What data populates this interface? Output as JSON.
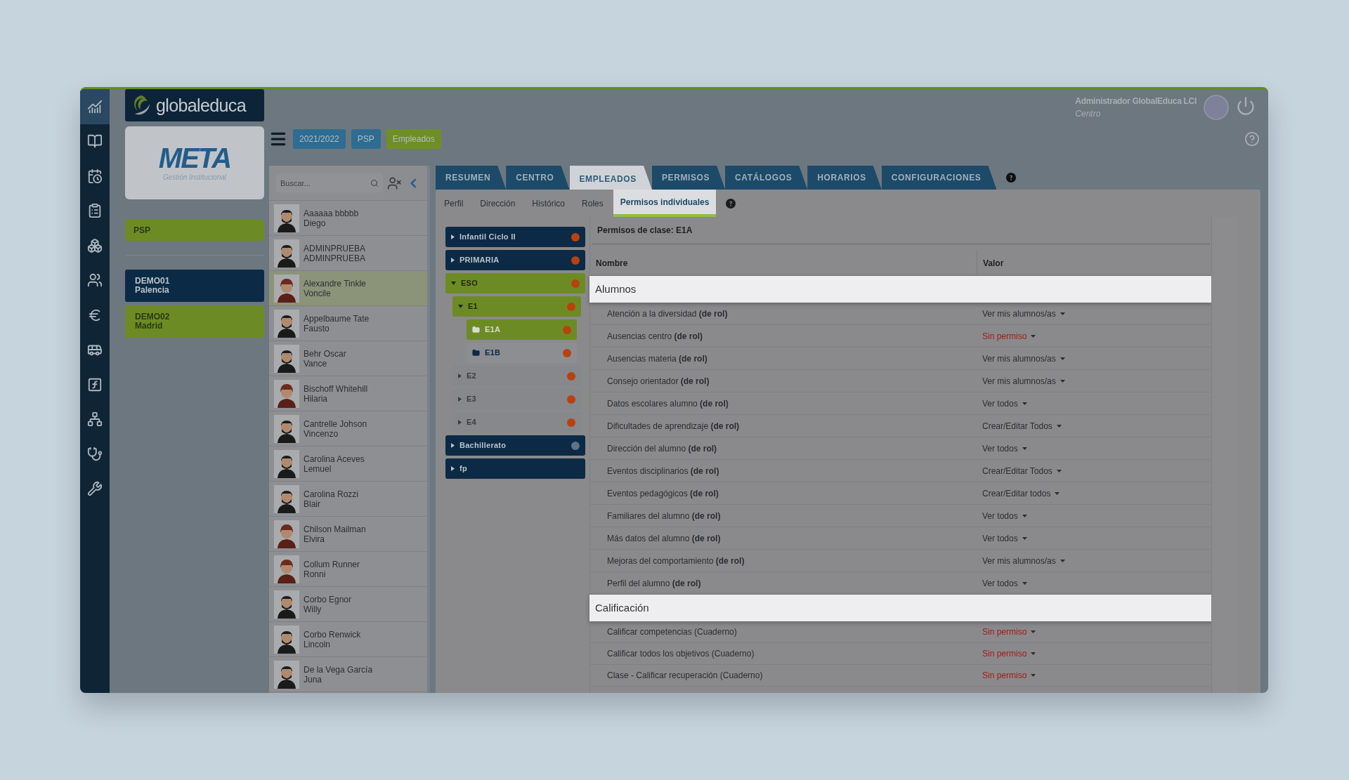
{
  "rail": [
    {
      "selected": true
    },
    {
      "selected": false
    },
    {
      "selected": false
    },
    {
      "selected": false
    },
    {
      "selected": false
    },
    {
      "selected": false
    },
    {
      "selected": false
    },
    {
      "selected": false
    },
    {
      "selected": false
    },
    {
      "selected": false
    },
    {
      "selected": false
    },
    {
      "selected": false
    }
  ],
  "brand": {
    "logo": "globaleduca",
    "product": "META",
    "product_subtitle": "Gestión Institucional"
  },
  "school": {
    "label": "PSP"
  },
  "centers": [
    {
      "code": "DEMO01",
      "city": "Palencia",
      "selected": true
    },
    {
      "code": "DEMO02",
      "city": "Madrid",
      "selected": false
    }
  ],
  "user": {
    "name": "Administrador GlobalEduca LCI",
    "role": "Centro"
  },
  "chips": [
    {
      "label": "2021/2022",
      "color": "#2e6c92"
    },
    {
      "label": "PSP",
      "color": "#2e6c92"
    },
    {
      "label": "Empleados",
      "color": "#6f8f24"
    }
  ],
  "search": {
    "placeholder": "Buscar..."
  },
  "employees": [
    {
      "surname": "Aaaaaa bbbbb",
      "name": "Diego",
      "kind": "male",
      "selected": false
    },
    {
      "surname": "ADMINPRUEBA",
      "name": "ADMINPRUEBA",
      "kind": "male",
      "selected": false
    },
    {
      "surname": "Alexandre Tinkle",
      "name": "Voncile",
      "kind": "female",
      "selected": true
    },
    {
      "surname": "Appelbaume Tate",
      "name": "Fausto",
      "kind": "male",
      "selected": false
    },
    {
      "surname": "Behr Oscar",
      "name": "Vance",
      "kind": "male",
      "selected": false
    },
    {
      "surname": "Bischoff Whitehill",
      "name": "Hilaria",
      "kind": "female",
      "selected": false
    },
    {
      "surname": "Cantrelle Johson",
      "name": "Vincenzo",
      "kind": "male",
      "selected": false
    },
    {
      "surname": "Carolina Aceves",
      "name": "Lemuel",
      "kind": "male",
      "selected": false
    },
    {
      "surname": "Carolina Rozzi",
      "name": "Blair",
      "kind": "male",
      "selected": false
    },
    {
      "surname": "Chilson Mailman",
      "name": "Elvira",
      "kind": "female",
      "selected": false
    },
    {
      "surname": "Collum Runner",
      "name": "Ronni",
      "kind": "female",
      "selected": false
    },
    {
      "surname": "Corbo Egnor",
      "name": "Willy",
      "kind": "male",
      "selected": false
    },
    {
      "surname": "Corbo Renwick",
      "name": "Lincoln",
      "kind": "male",
      "selected": false
    },
    {
      "surname": "De la Vega García",
      "name": "Juna",
      "kind": "male",
      "selected": false
    }
  ],
  "tabs": [
    {
      "label": "RESUMEN",
      "selected": false
    },
    {
      "label": "CENTRO",
      "selected": false
    },
    {
      "label": "EMPLEADOS",
      "selected": true
    },
    {
      "label": "PERMISOS",
      "selected": false
    },
    {
      "label": "CATÁLOGOS",
      "selected": false
    },
    {
      "label": "HORARIOS",
      "selected": false
    },
    {
      "label": "CONFIGURACIONES",
      "selected": false
    }
  ],
  "subtabs": [
    {
      "label": "Perfil",
      "selected": false
    },
    {
      "label": "Dirección",
      "selected": false
    },
    {
      "label": "Histórico",
      "selected": false
    },
    {
      "label": "Roles",
      "selected": false
    },
    {
      "label": "Permisos individuales",
      "selected": true
    }
  ],
  "tree": [
    {
      "label": "Infantil Ciclo II",
      "kind": "group",
      "expanded": false,
      "color": "#b8420f"
    },
    {
      "label": "PRIMARIA",
      "kind": "group",
      "expanded": false,
      "color": "#b8420f"
    },
    {
      "label": "ESO",
      "kind": "group",
      "expanded": true,
      "color": "#b8420f",
      "children": [
        {
          "label": "E1",
          "kind": "group",
          "expanded": true,
          "color": "#b8420f",
          "children": [
            {
              "label": "E1A",
              "kind": "folder",
              "selected": true,
              "color": "#b8420f"
            },
            {
              "label": "E1B",
              "kind": "folder",
              "selected": false,
              "color": "#b8420f"
            }
          ]
        },
        {
          "label": "E2",
          "kind": "group",
          "expanded": false,
          "color": "#b8420f"
        },
        {
          "label": "E3",
          "kind": "group",
          "expanded": false,
          "color": "#b8420f"
        },
        {
          "label": "E4",
          "kind": "group",
          "expanded": false,
          "color": "#b8420f"
        }
      ]
    },
    {
      "label": "Bachillerato",
      "kind": "group",
      "expanded": false,
      "color": "#5d7488"
    },
    {
      "label": "fp",
      "kind": "group",
      "expanded": false
    }
  ],
  "permissions": {
    "title": "Permisos de clase: E1A",
    "columns": [
      "Nombre",
      "Valor"
    ],
    "groups": [
      {
        "title": "Alumnos",
        "rows": [
          {
            "name": "Atención a la diversidad **(de rol)**",
            "value": "Ver mis alumnos/as",
            "denied": false
          },
          {
            "name": "Ausencias centro **(de rol)**",
            "value": "Sin permiso",
            "denied": true
          },
          {
            "name": "Ausencias materia **(de rol)**",
            "value": "Ver mis alumnos/as",
            "denied": false
          },
          {
            "name": "Consejo orientador **(de rol)**",
            "value": "Ver mis alumnos/as",
            "denied": false
          },
          {
            "name": "Datos escolares alumno **(de rol)**",
            "value": "Ver todos",
            "denied": false
          },
          {
            "name": "Dificultades de aprendizaje **(de rol)**",
            "value": "Crear/Editar Todos",
            "denied": false
          },
          {
            "name": "Dirección del alumno **(de rol)**",
            "value": "Ver todos",
            "denied": false
          },
          {
            "name": "Eventos disciplinarios **(de rol)**",
            "value": "Crear/Editar Todos",
            "denied": false
          },
          {
            "name": "Eventos pedagógicos **(de rol)**",
            "value": "Crear/Editar todos",
            "denied": false
          },
          {
            "name": "Familiares del alumno **(de rol)**",
            "value": "Ver todos",
            "denied": false
          },
          {
            "name": "Más datos del alumno **(de rol)**",
            "value": "Ver todos",
            "denied": false
          },
          {
            "name": "Mejoras del comportamiento **(de rol)**",
            "value": "Ver mis alumnos/as",
            "denied": false
          },
          {
            "name": "Perfil del alumno **(de rol)**",
            "value": "Ver todos",
            "denied": false
          }
        ]
      },
      {
        "title": "Calificación",
        "rows": [
          {
            "name": "Calificar competencias (Cuaderno)",
            "value": "Sin permiso",
            "denied": true
          },
          {
            "name": "Calificar todos los objetivos (Cuaderno)",
            "value": "Sin permiso",
            "denied": true
          },
          {
            "name": "Clase - Calificar recuperación (Cuaderno)",
            "value": "Sin permiso",
            "denied": true
          }
        ]
      }
    ]
  }
}
